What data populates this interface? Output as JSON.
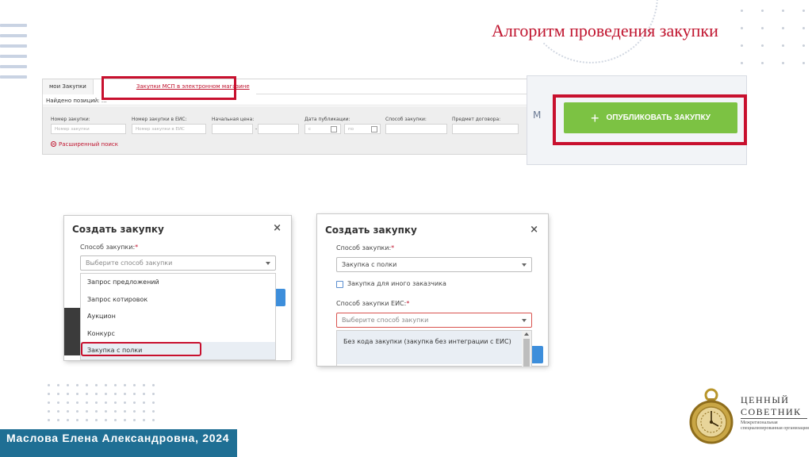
{
  "slide": {
    "title": "Алгоритм проведения закупки",
    "author": "Маслова Елена Александровна, 2024"
  },
  "filter_panel": {
    "tabs": [
      "мои Закупки",
      "Закупки МСП в электронном магазине"
    ],
    "found_label": "Найдено позиций: ...",
    "fields": {
      "number_label": "Номер закупки:",
      "number_placeholder": "Номер закупки",
      "eis_label": "Номер закупки в ЕИС:",
      "eis_placeholder": "Номер закупки в ЕИС",
      "price_label": "Начальная цена:",
      "price_sep": "-",
      "date_label": "Дата публикации:",
      "date_from": "с",
      "date_to": "по",
      "method_label": "Способ закупки:",
      "subject_label": "Предмет договора:"
    },
    "advanced_search": "Расширенный поиск"
  },
  "publish": {
    "side_letter": "М",
    "button_label": "ОПУБЛИКОВАТЬ ЗАКУПКУ",
    "plus": "+"
  },
  "dialog1": {
    "title": "Создать закупку",
    "close": "×",
    "method_label": "Способ закупки:",
    "required_mark": "*",
    "select_placeholder": "Выберите способ закупки",
    "options": [
      "Запрос предложений",
      "Запрос котировок",
      "Аукцион",
      "Конкурс",
      "Закупка с полки"
    ],
    "selected_index": 4
  },
  "dialog2": {
    "title": "Создать закупку",
    "close": "×",
    "method_label": "Способ закупки:",
    "required_mark": "*",
    "method_value": "Закупка с полки",
    "other_customer_label": "Закупка для иного заказчика",
    "other_customer_checked": false,
    "eis_method_label": "Способ закупки ЕИС:",
    "eis_select_placeholder": "Выберите способ закупки",
    "eis_options": [
      "Без кода закупки (закупка без интеграции с ЕИС)"
    ]
  },
  "logo": {
    "line1": "ЦЕННЫЙ",
    "line2": "СОВЕТНИК",
    "subtitle": "Межрегиональная специализированная организация"
  },
  "colors": {
    "accent_red": "#c0152f",
    "publish_green": "#7cc243",
    "footer_blue": "#1f6f94"
  }
}
